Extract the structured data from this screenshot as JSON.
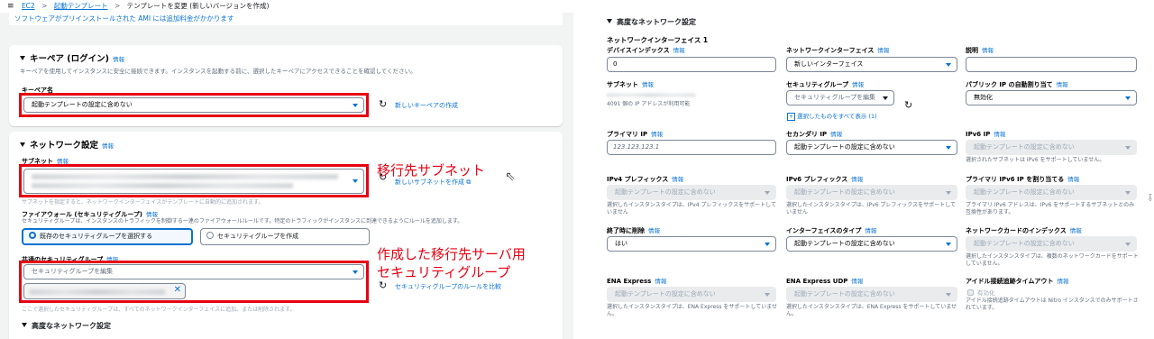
{
  "breadcrumb": {
    "menu_icon": "≡",
    "items": [
      "EC2",
      "起動テンプレート",
      "テンプレートを変更 (新しいバージョンを作成)"
    ],
    "sep": ">"
  },
  "ami_note": "ソフトウェアがプリインストールされた AMI には追加料金がかかります",
  "keypair": {
    "title": "キーペア (ログイン)",
    "info": "情報",
    "desc": "キーペアを使用してインスタンスに安全に接続できます。インスタンスを起動する前に、選択したキーペアにアクセスできることを確認してください。",
    "label": "キーペア名",
    "value": "起動テンプレートの設定に含めない",
    "new_link": "新しいキーペアの作成"
  },
  "network": {
    "title": "ネットワーク設定",
    "info": "情報",
    "subnet_label": "サブネット",
    "subnet_info": "情報",
    "subnet_new_link": "新しいサブネットを作成",
    "subnet_hint": "サブネットを指定すると、ネットワークインターフェイスがテンプレートに自動的に追加されます。",
    "firewall_label": "ファイアウォール (セキュリティグループ)",
    "firewall_info": "情報",
    "firewall_desc": "セキュリティグループは、インスタンスのトラフィックを制御する一連のファイアウォールルールです。特定のトラフィックがインスタンスに到達できるようにルールを追加します。",
    "radio_existing": "既存のセキュリティグループを選択する",
    "radio_create": "セキュリティグループを作成",
    "common_sg_label": "共通のセキュリティグループ",
    "common_sg_info": "情報",
    "common_sg_placeholder": "セキュリティグループを編集",
    "compare_link": "セキュリティグループのルールを比較",
    "sg_footer": "ここで選択したセキュリティグループは、すべてのネットワークインターフェイスに追加、または削除されます。",
    "advanced_title": "高度なネットワーク設定"
  },
  "annotations": {
    "subnet": "移行先サブネット",
    "sg_line1": "作成した移行先サーバ用",
    "sg_line2": "セキュリティグループ"
  },
  "adv": {
    "title": "高度なネットワーク設定",
    "ni_title": "ネットワークインターフェイス 1",
    "info": "情報",
    "device_index_label": "デバイスインデックス",
    "device_index_value": "0",
    "ni_label": "ネットワークインターフェイス",
    "ni_value": "新しいインターフェイス",
    "desc_label": "説明",
    "subnet_label": "サブネット",
    "subnet_ip_note": "4091 個の IP アドレスが利用可能",
    "sg_label": "セキュリティグループ",
    "sg_placeholder": "セキュリティグループを編集",
    "sg_show_all": "選択したものをすべて表示 (1)",
    "public_ip_label": "パブリック IP の自動割り当て",
    "public_ip_value": "無効化",
    "primary_ip_label": "プライマリ IP",
    "primary_ip_value": "123.123.123.1",
    "secondary_ip_label": "セカンダリ IP",
    "secondary_ip_value": "起動テンプレートの設定に含めない",
    "ipv6_label": "IPv6 IP",
    "ipv6_value": "起動テンプレートの設定に含めない",
    "ipv6_note": "選択されたサブネットは IPv6 をサポートしていません。",
    "ipv4_prefix_label": "IPv4 プレフィックス",
    "ipv4_prefix_value": "起動テンプレートの設定に含めない",
    "ipv4_prefix_note": "選択したインスタンスタイプは、IPv4 プレフィックスをサポートしていません",
    "ipv6_prefix_label": "IPv6 プレフィックス",
    "ipv6_prefix_value": "起動テンプレートの設定に含めない",
    "ipv6_prefix_note": "選択したインスタンスタイプは、IPv6 プレフィックスをサポートしていません",
    "primary_ipv6_label": "プライマリ IPv6 IP を割り当てる",
    "primary_ipv6_value": "起動テンプレートの設定に含めない",
    "primary_ipv6_note": "プライマリ IPv6 アドレスは、IPv6 をサポートするサブネットとのみ互換性があります。",
    "delete_label": "終了時に削除",
    "delete_value": "はい",
    "if_type_label": "インターフェイスのタイプ",
    "if_type_value": "起動テンプレートの設定に含めない",
    "card_index_label": "ネットワークカードのインデックス",
    "card_index_value": "起動テンプレートの設定に含めない",
    "card_index_note": "選択したインスタンスタイプは、複数のネットワークカードをサポートしていません。",
    "ena_label": "ENA Express",
    "ena_value": "起動テンプレートの設定に含めない",
    "ena_note": "選択したインスタンスタイプは、ENA Express をサポートしていません。",
    "ena_udp_label": "ENA Express UDP",
    "ena_udp_value": "起動テンプレートの設定に含めない",
    "ena_udp_note": "選択したインスタンスタイプは、ENA Express をサポートしていません。",
    "idle_label": "アイドル接続追跡タイムアウト",
    "idle_checkbox": "有効化",
    "idle_note": "アイドル接続追跡タイムアウトは Nitro インスタンスでのみサポートされています。"
  }
}
